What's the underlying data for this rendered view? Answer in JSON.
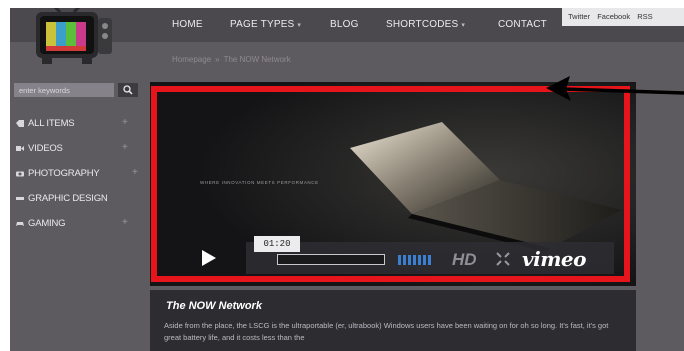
{
  "nav": {
    "items": [
      "HOME",
      "PAGE TYPES",
      "BLOG",
      "SHORTCODES",
      "CONTACT"
    ],
    "dropdown_flags": [
      false,
      true,
      false,
      true,
      false
    ],
    "social": [
      "Twitter",
      "Facebook",
      "RSS"
    ]
  },
  "breadcrumb": [
    "Homepage",
    "The NOW Network"
  ],
  "search": {
    "placeholder": "enter keywords"
  },
  "sidebar": {
    "items": [
      {
        "label": "ALL ITEMS",
        "icon": "tag-icon"
      },
      {
        "label": "VIDEOS",
        "icon": "video-icon"
      },
      {
        "label": "PHOTOGRAPHY",
        "icon": "camera-icon"
      },
      {
        "label": "GRAPHIC DESIGN",
        "icon": "design-icon"
      },
      {
        "label": "GAMING",
        "icon": "gamepad-icon"
      }
    ]
  },
  "video": {
    "time": "01:20",
    "progress": 0.0,
    "hd_label": "HD",
    "brand": "vimeo",
    "overlay_text": "WHERE INNOVATION MEETS PERFORMANCE"
  },
  "article": {
    "title": "The NOW Network",
    "body": "Aside from the place, the LSCG is the ultraportable (er, ultrabook) Windows users have been waiting on for oh so long. It's fast, it's got great battery life, and it costs less than the"
  },
  "colors": {
    "highlight": "#e8141c",
    "page_bg": "#5e5b60",
    "nav_bg": "#4b494d",
    "panel_bg": "#2d2c31"
  }
}
